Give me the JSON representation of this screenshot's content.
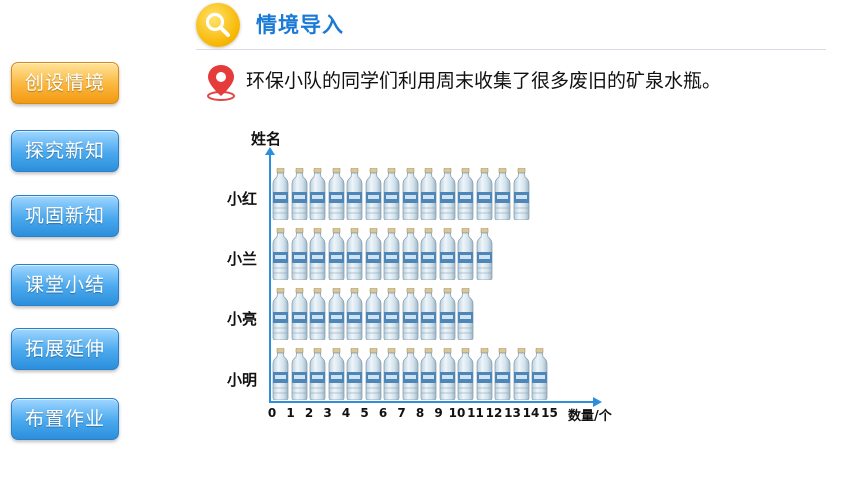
{
  "header": {
    "title": "情境导入",
    "icon": "magnifier-icon"
  },
  "sidebar": {
    "items": [
      {
        "label": "创设情境",
        "active": true
      },
      {
        "label": "探究新知",
        "active": false
      },
      {
        "label": "巩固新知",
        "active": false
      },
      {
        "label": "课堂小结",
        "active": false
      },
      {
        "label": "拓展延伸",
        "active": false
      },
      {
        "label": "布置作业",
        "active": false
      }
    ],
    "colors": {
      "active": "#f7a21b",
      "inactive": "#3a9be6"
    }
  },
  "intro": {
    "icon": "location-pin-icon",
    "text": "环保小队的同学们利用周末收集了很多废旧的矿泉水瓶。"
  },
  "chart_data": {
    "type": "bar",
    "orientation": "horizontal",
    "mark": "bottle-pictograph",
    "ytitle": "姓名",
    "xtitle": "数量/个",
    "categories": [
      "小红",
      "小兰",
      "小亮",
      "小明"
    ],
    "values": [
      14,
      12,
      11,
      15
    ],
    "xlim": [
      0,
      15
    ],
    "xticks": [
      "0",
      "1",
      "2",
      "3",
      "4",
      "5",
      "6",
      "7",
      "8",
      "9",
      "10",
      "11",
      "12",
      "13",
      "14",
      "15"
    ],
    "axis_color": "#2c8fdc"
  }
}
